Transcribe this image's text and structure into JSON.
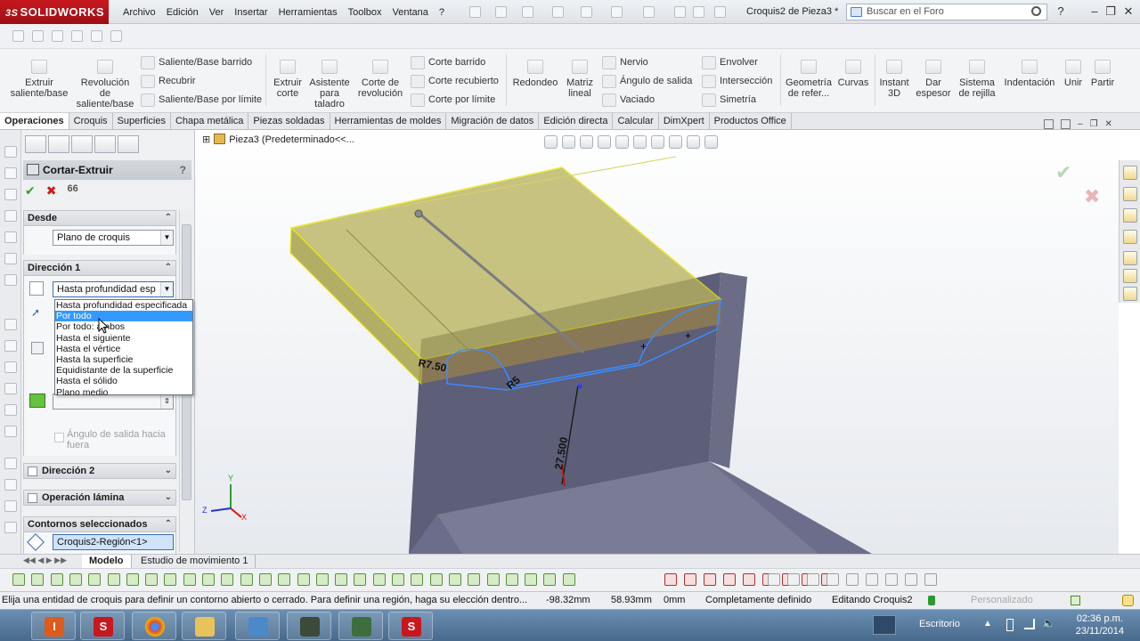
{
  "app": {
    "brand": "SOLIDWORKS",
    "brand_prefix": "3S",
    "doc_title": "Croquis2 de Pieza3 *"
  },
  "menu": [
    "Archivo",
    "Edición",
    "Ver",
    "Insertar",
    "Herramientas",
    "Toolbox",
    "Ventana",
    "?"
  ],
  "search": {
    "placeholder": "Buscar en el Foro"
  },
  "window_buttons": [
    "?",
    "–",
    "❐",
    "✕"
  ],
  "ribbon": {
    "extruir_saliente": "Extruir saliente/base",
    "revolucion_saliente": "Revolución de saliente/base",
    "saliente_barrido": "Saliente/Base barrido",
    "recubrir": "Recubrir",
    "saliente_limite": "Saliente/Base por límite",
    "extruir_corte": "Extruir corte",
    "asistente_taladro": "Asistente para taladro",
    "corte_revolucion": "Corte de revolución",
    "corte_barrido": "Corte barrido",
    "corte_recubierto": "Corte recubierto",
    "corte_limite": "Corte por límite",
    "redondeo": "Redondeo",
    "matriz_lineal": "Matriz lineal",
    "nervio": "Nervio",
    "angulo_salida": "Ángulo de salida",
    "vaciado": "Vaciado",
    "envolver": "Envolver",
    "interseccion": "Intersección",
    "simetria": "Simetría",
    "geometria_ref": "Geometría de refer...",
    "curvas": "Curvas",
    "instant3d": "Instant 3D",
    "dar_espesor": "Dar espesor",
    "sistema_rejilla": "Sistema de rejilla",
    "indentacion": "Indentación",
    "unir": "Unir",
    "partir": "Partir"
  },
  "tabs": [
    "Operaciones",
    "Croquis",
    "Superficies",
    "Chapa metálica",
    "Piezas soldadas",
    "Herramientas de moldes",
    "Migración de datos",
    "Edición directa",
    "Calcular",
    "DimXpert",
    "Productos Office"
  ],
  "active_tab": "Operaciones",
  "pm": {
    "title": "Cortar-Extruir",
    "help": "?",
    "ok": "✔",
    "cancel": "✖",
    "detail": "66",
    "desde_label": "Desde",
    "desde_value": "Plano de croquis",
    "dir1_label": "Dirección 1",
    "dir1_value": "Hasta profundidad esp",
    "dropdown_options": [
      "Hasta profundidad especificada",
      "Por todo",
      "Por todo: ambos",
      "Hasta el siguiente",
      "Hasta el vértice",
      "Hasta la superficie",
      "Equidistante de la superficie",
      "Hasta el sólido",
      "Plano medio"
    ],
    "dropdown_selected_index": 1,
    "angle_label": "Ángulo de salida hacia fuera",
    "dir2_label": "Dirección 2",
    "lamina_label": "Operación lámina",
    "contornos_label": "Contornos seleccionados",
    "contorno_value": "Croquis2-Región<1>"
  },
  "viewport": {
    "tree_label": "Pieza3  (Predeterminado<<...",
    "dim_radius": "R7.50",
    "dim_radius2": "R5",
    "dim_length": "27.500",
    "axis_x": "X",
    "axis_y": "Y",
    "axis_z": "Z"
  },
  "model_tabs": [
    "Modelo",
    "Estudio de movimiento 1"
  ],
  "status": {
    "message": "Elija una entidad de croquis para definir un contorno abierto o cerrado. Para definir una región, haga su elección dentro...",
    "x": "-98.32mm",
    "y": "58.93mm",
    "z": "0mm",
    "state": "Completamente definido",
    "editing": "Editando Croquis2",
    "custom": "Personalizado"
  },
  "taskbar": {
    "desktop": "Escritorio",
    "time": "02:36 p.m.",
    "date": "23/11/2014"
  },
  "colors": {
    "brand_red": "#b0141b",
    "selection_blue": "#3399ff",
    "accept_green": "#2e9e2e",
    "cancel_red": "#d11a1a"
  }
}
